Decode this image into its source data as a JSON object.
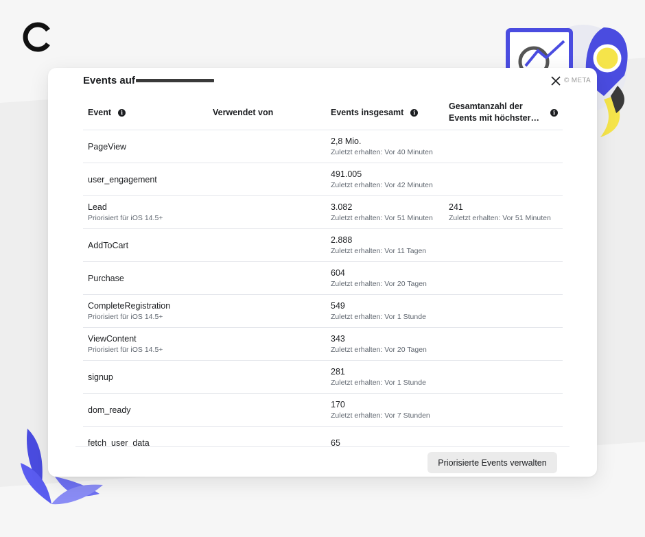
{
  "modal": {
    "title": "Events auf",
    "meta_credit": "© META"
  },
  "table": {
    "headers": {
      "event": "Event",
      "used_by": "Verwendet von",
      "total": "Events insgesamt",
      "highest": "Gesamtanzahl der Events mit höchster…"
    },
    "rows": [
      {
        "name": "PageView",
        "tag": "",
        "total": "2,8 Mio.",
        "total_sub": "Zuletzt erhalten: Vor 40 Minuten",
        "high": "",
        "high_sub": ""
      },
      {
        "name": "user_engagement",
        "tag": "",
        "total": "491.005",
        "total_sub": "Zuletzt erhalten: Vor 42 Minuten",
        "high": "",
        "high_sub": ""
      },
      {
        "name": "Lead",
        "tag": "Priorisiert für iOS 14.5+",
        "total": "3.082",
        "total_sub": "Zuletzt erhalten: Vor 51 Minuten",
        "high": "241",
        "high_sub": "Zuletzt erhalten: Vor 51 Minuten"
      },
      {
        "name": "AddToCart",
        "tag": "",
        "total": "2.888",
        "total_sub": "Zuletzt erhalten: Vor 11 Tagen",
        "high": "",
        "high_sub": ""
      },
      {
        "name": "Purchase",
        "tag": "",
        "total": "604",
        "total_sub": "Zuletzt erhalten: Vor 20 Tagen",
        "high": "",
        "high_sub": ""
      },
      {
        "name": "CompleteRegistration",
        "tag": "Priorisiert für iOS 14.5+",
        "total": "549",
        "total_sub": "Zuletzt erhalten: Vor 1 Stunde",
        "high": "",
        "high_sub": ""
      },
      {
        "name": "ViewContent",
        "tag": "Priorisiert für iOS 14.5+",
        "total": "343",
        "total_sub": "Zuletzt erhalten: Vor 20 Tagen",
        "high": "",
        "high_sub": ""
      },
      {
        "name": "signup",
        "tag": "",
        "total": "281",
        "total_sub": "Zuletzt erhalten: Vor 1 Stunde",
        "high": "",
        "high_sub": ""
      },
      {
        "name": "dom_ready",
        "tag": "",
        "total": "170",
        "total_sub": "Zuletzt erhalten: Vor 7 Stunden",
        "high": "",
        "high_sub": ""
      },
      {
        "name": "fetch_user_data",
        "tag": "",
        "total": "65",
        "total_sub": "",
        "high": "",
        "high_sub": ""
      }
    ]
  },
  "footer": {
    "manage_label": "Priorisierte Events verwalten"
  },
  "colors": {
    "accent_blue": "#4a4ce0",
    "accent_yellow": "#f5e44a"
  },
  "icons": {
    "logo": "circle-arc-logo-icon",
    "close": "close-icon",
    "info": "info-icon"
  }
}
